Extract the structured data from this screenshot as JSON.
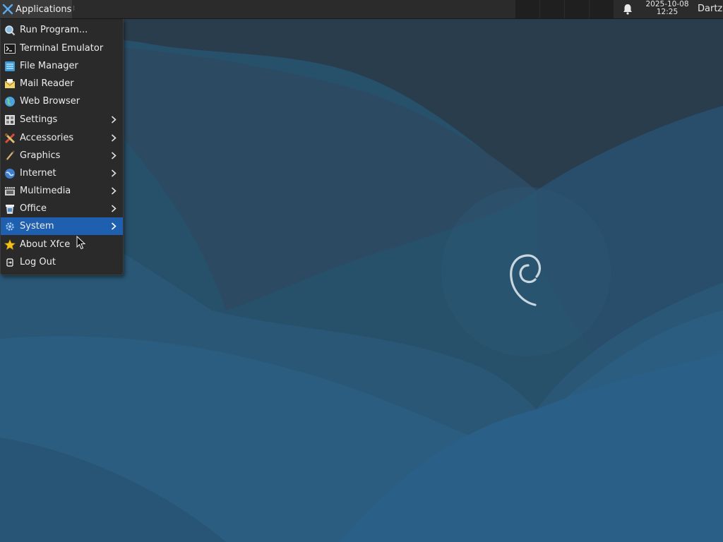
{
  "panel": {
    "applications_label": "Applications",
    "separator_glyph": "⁝",
    "clock_date": "2025-10-08",
    "clock_time": "12:25",
    "user_label": "Dartz",
    "workspace_count": 4
  },
  "menu": {
    "items": [
      {
        "label": "Run Program...",
        "icon": "run-program-icon",
        "submenu": false
      },
      {
        "label": "Terminal Emulator",
        "icon": "terminal-icon",
        "submenu": false
      },
      {
        "label": "File Manager",
        "icon": "file-manager-icon",
        "submenu": false
      },
      {
        "label": "Mail Reader",
        "icon": "mail-icon",
        "submenu": false
      },
      {
        "label": "Web Browser",
        "icon": "web-browser-icon",
        "submenu": false
      },
      {
        "label": "Settings",
        "icon": "settings-icon",
        "submenu": true
      },
      {
        "label": "Accessories",
        "icon": "accessories-icon",
        "submenu": true
      },
      {
        "label": "Graphics",
        "icon": "graphics-icon",
        "submenu": true
      },
      {
        "label": "Internet",
        "icon": "internet-icon",
        "submenu": true
      },
      {
        "label": "Multimedia",
        "icon": "multimedia-icon",
        "submenu": true
      },
      {
        "label": "Office",
        "icon": "office-icon",
        "submenu": true
      },
      {
        "label": "System",
        "icon": "system-icon",
        "submenu": true,
        "highlighted": true
      },
      {
        "label": "About Xfce",
        "icon": "star-icon",
        "submenu": false
      },
      {
        "label": "Log Out",
        "icon": "logout-icon",
        "submenu": false
      }
    ]
  },
  "colors": {
    "panel_bg": "#2b2b2b",
    "menu_bg": "#2a2a2a",
    "highlight": "#1f5fb0",
    "wallpaper_base": "#24506e"
  }
}
